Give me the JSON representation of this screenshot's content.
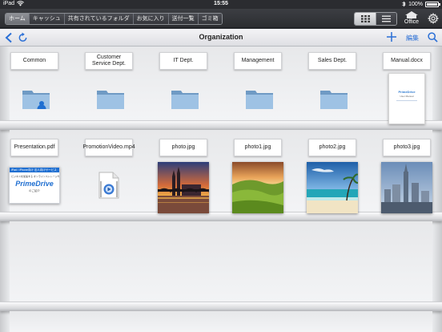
{
  "status_bar": {
    "device": "iPad",
    "time": "15:55",
    "battery": "100%",
    "battery_level": 1.0
  },
  "toolbar": {
    "tabs": [
      {
        "label": "ホーム",
        "active": true
      },
      {
        "label": "キャッシュ",
        "active": false
      },
      {
        "label": "共有されているフォルダ",
        "active": false
      },
      {
        "label": "お気に入り",
        "active": false
      },
      {
        "label": "送付一覧",
        "active": false
      },
      {
        "label": "ゴミ箱",
        "active": false
      }
    ],
    "office_label": "Office"
  },
  "navbar": {
    "title": "Organization",
    "edit_label": "編集"
  },
  "shelves": [
    {
      "items": [
        {
          "label": "Common",
          "kind": "folder-shared"
        },
        {
          "label": "Customer Service Dept.",
          "kind": "folder"
        },
        {
          "label": "IT Dept.",
          "kind": "folder"
        },
        {
          "label": "Management",
          "kind": "folder"
        },
        {
          "label": "Sales Dept.",
          "kind": "folder"
        },
        {
          "label": "Manual.docx",
          "kind": "document"
        }
      ]
    },
    {
      "items": [
        {
          "label": "Presentation.pdf",
          "kind": "pdf"
        },
        {
          "label": "PromotionVideo.mp4",
          "kind": "video"
        },
        {
          "label": "photo.jpg",
          "kind": "photo-city"
        },
        {
          "label": "photo1.jpg",
          "kind": "photo-hills"
        },
        {
          "label": "photo2.jpg",
          "kind": "photo-beach"
        },
        {
          "label": "photo3.jpg",
          "kind": "photo-skyline"
        }
      ]
    }
  ],
  "document_preview": {
    "brand": "PrimeDrive",
    "title": "User Manual"
  },
  "pdf_preview": {
    "headline": "iPad / iPhone向け 法人向けサービス",
    "subline": "ビジネスを加速する オンラインストレージサービス",
    "brand": "PrimeDrive",
    "footer": "のご紹介"
  },
  "colors": {
    "accent": "#2a6fd6",
    "folder": "#8eb4d8",
    "toolbar": "#2c2d31"
  }
}
